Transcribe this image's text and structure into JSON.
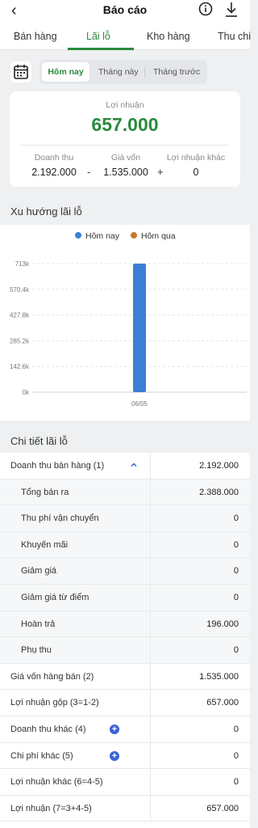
{
  "header": {
    "title": "Báo cáo"
  },
  "tabs": [
    {
      "label": "Bán hàng",
      "active": false
    },
    {
      "label": "Lãi lỗ",
      "active": true
    },
    {
      "label": "Kho hàng",
      "active": false
    },
    {
      "label": "Thu chi",
      "active": false
    }
  ],
  "filter": {
    "options": [
      "Hôm nay",
      "Tháng này",
      "Tháng trước"
    ],
    "selected": "Hôm nay"
  },
  "summary": {
    "label": "Lợi nhuận",
    "value": "657.000",
    "revenue_label": "Doanh thu",
    "revenue": "2.192.000",
    "cost_label": "Giá vốn",
    "cost": "1.535.000",
    "other_label": "Lợi nhuận khác",
    "other": "0",
    "op_minus": "-",
    "op_plus": "+"
  },
  "trend": {
    "title": "Xu hướng lãi lỗ"
  },
  "chart_data": {
    "type": "bar",
    "categories": [
      "06/05"
    ],
    "series": [
      {
        "name": "Hôm nay",
        "color": "#3a7fd6",
        "values": [
          713000
        ]
      },
      {
        "name": "Hôm qua",
        "color": "#c67a2e",
        "values": [
          0
        ]
      }
    ],
    "yticks": [
      "0k",
      "142.6k",
      "285.2k",
      "427.8k",
      "570.4k",
      "713k"
    ],
    "ylim": [
      0,
      713000
    ],
    "legend_position": "top"
  },
  "detail": {
    "title": "Chi tiết lãi lỗ",
    "rows": [
      {
        "label": "Doanh thu bán hàng (1)",
        "value": "2.192.000",
        "sub": false,
        "icon": "chevron-up"
      },
      {
        "label": "Tổng bán ra",
        "value": "2.388.000",
        "sub": true
      },
      {
        "label": "Thu phí vận chuyển",
        "value": "0",
        "sub": true
      },
      {
        "label": "Khuyến mãi",
        "value": "0",
        "sub": true
      },
      {
        "label": "Giảm giá",
        "value": "0",
        "sub": true
      },
      {
        "label": "Giảm giá từ điểm",
        "value": "0",
        "sub": true
      },
      {
        "label": "Hoàn trả",
        "value": "196.000",
        "sub": true
      },
      {
        "label": "Phụ thu",
        "value": "0",
        "sub": true
      },
      {
        "label": "Giá vốn hàng bán (2)",
        "value": "1.535.000",
        "sub": false
      },
      {
        "label": "Lợi nhuận gộp (3=1-2)",
        "value": "657.000",
        "sub": false
      },
      {
        "label": "Doanh thu khác (4)",
        "value": "0",
        "sub": false,
        "icon": "plus"
      },
      {
        "label": "Chi phí khác (5)",
        "value": "0",
        "sub": false,
        "icon": "plus"
      },
      {
        "label": "Lợi nhuận khác (6=4-5)",
        "value": "0",
        "sub": false
      },
      {
        "label": "Lợi nhuận (7=3+4-5)",
        "value": "657.000",
        "sub": false
      }
    ]
  },
  "colors": {
    "accent": "#2a8a3e",
    "bar": "#3a7fd6",
    "bar2": "#c67a2e",
    "plus": "#3a63d6"
  }
}
